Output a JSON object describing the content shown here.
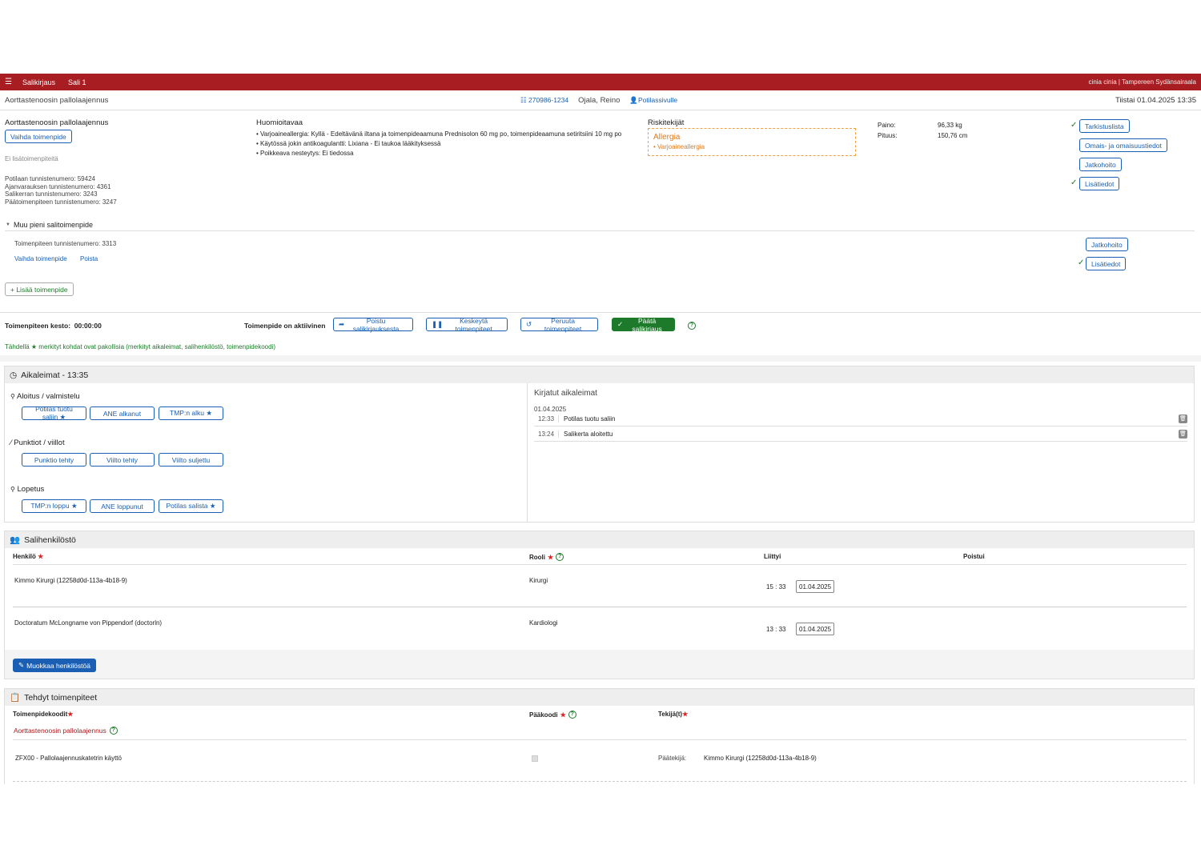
{
  "topbar": {
    "app": "Salikirjaus",
    "room": "Sali 1",
    "user_org": "cinia cinia | Tampereen Sydänsairaala"
  },
  "patient": {
    "procedure": "Aorttastenoosin pallolaajennus",
    "id": "270986-1234",
    "name": "Ojala, Reino",
    "page_link": "Potilassivulle",
    "datetime": "Tiistai 01.04.2025 13:35"
  },
  "main_procedure": {
    "title": "Aorttastenoosin pallolaajennus",
    "change_btn": "Vaihda toimenpide",
    "no_extra": "Ei lisätoimenpiteitä",
    "ids": [
      "Potilaan tunnistenumero: 59424",
      "Ajanvarauksen tunnistenumero: 4361",
      "Salikerran tunnistenumero: 3243",
      "Päätoimenpiteen tunnistenumero: 3247"
    ]
  },
  "notes": {
    "title": "Huomioitavaa",
    "items": [
      "• Varjoaineallergia: Kyllä - Edeltävänä iltana ja toimenpideaamuna Prednisolon 60 mg po, toimenpideaamuna setiritsiini 10 mg po",
      "• Käytössä jokin antikoagulantti: Lixiana - Ei taukoa lääkityksessä",
      "• Poikkeava nesteytys: Ei tiedossa"
    ]
  },
  "risks": {
    "title": "Riskitekijät",
    "head": "Allergia",
    "item": "• Varjoaineallergia"
  },
  "vitals": {
    "weight_label": "Paino:",
    "weight": "96,33 kg",
    "height_label": "Pituus:",
    "height": "150,76 cm"
  },
  "side_buttons": {
    "checklist": "Tarkistuslista",
    "relatives": "Omais- ja omaisuustiedot",
    "followup": "Jatkohoito",
    "extra": "Lisätiedot"
  },
  "minor": {
    "title": "Muu pieni salitoimenpide",
    "id": "Toimenpiteen tunnistenumero: 3313",
    "change": "Vaihda toimenpide",
    "remove": "Poista",
    "followup": "Jatkohoito",
    "extra": "Lisätiedot",
    "add": "+ Lisää toimenpide"
  },
  "status": {
    "duration_label": "Toimenpiteen kesto:",
    "duration": "00:00:00",
    "active": "Toimenpide on aktiivinen",
    "exit": "Poistu salikirjauksesta",
    "pause": "Keskeytä toimenpiteet",
    "cancel": "Peruuta toimenpiteet",
    "finish": "Päätä salikirjaus",
    "required_note": "Tähdellä ★ merkityt kohdat ovat pakollisia (merkityt aikaleimat, salihenkilöstö, toimenpidekoodi)"
  },
  "timestamps": {
    "title": "Aikaleimat - 13:35",
    "groups": [
      {
        "name": "Aloitus / valmistelu",
        "buttons": [
          "Potilas tuotu saliin ★",
          "ANE alkanut",
          "TMP:n alku ★"
        ]
      },
      {
        "name": "Punktiot / viillot",
        "buttons": [
          "Punktio tehty",
          "Viilto tehty",
          "Viilto suljettu"
        ]
      },
      {
        "name": "Lopetus",
        "buttons": [
          "TMP:n loppu ★",
          "ANE loppunut",
          "Potilas salista ★"
        ]
      }
    ],
    "logged_title": "Kirjatut aikaleimat",
    "logged_date": "01.04.2025",
    "logged": [
      {
        "time": "12:33",
        "label": "Potilas tuotu saliin"
      },
      {
        "time": "13:24",
        "label": "Salikerta aloitettu"
      }
    ]
  },
  "staff": {
    "title": "Salihenkilöstö",
    "col_person": "Henkilö",
    "col_role": "Rooli",
    "col_joined": "Liittyi",
    "col_left": "Poistui",
    "rows": [
      {
        "person": "Kimmo Kirurgi (12258d0d-113a-4b18-9)",
        "role": "Kirurgi",
        "time": "15 : 33",
        "date": "01.04.2025"
      },
      {
        "person": "Doctoratum McLongname von Pippendorf (doctorln)",
        "role": "Kardiologi",
        "time": "13 : 33",
        "date": "01.04.2025"
      }
    ],
    "edit": "Muokkaa henkilöstöä"
  },
  "done": {
    "title": "Tehdyt toimenpiteet",
    "col_codes": "Toimenpidekoodit",
    "col_main": "Pääkoodi",
    "col_doers": "Tekijä(t)",
    "procedure": "Aorttastenoosin pallolaajennus",
    "code": "ZFX00 - Pallolaajennuskatetrin käyttö",
    "doer_label": "Päätekijä:",
    "doer": "Kimmo Kirurgi (12258d0d-113a-4b18-9)"
  }
}
